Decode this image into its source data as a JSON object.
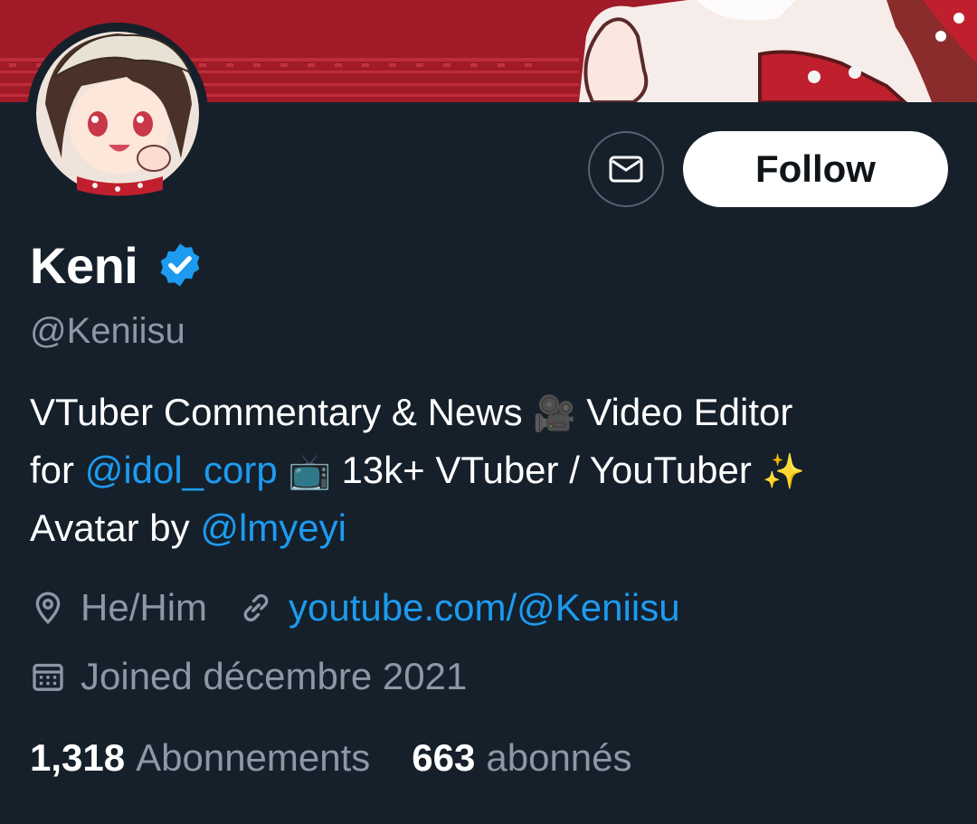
{
  "profile": {
    "display_name": "Keni",
    "handle": "@Keniisu",
    "bio": {
      "line1_text": "VTuber Commentary & News ",
      "line1_emoji": "🎥",
      "line1_end": " Video Editor",
      "line2_start": "for ",
      "line2_mention": "@idol_corp",
      "line2_emoji": " 📺",
      "line2_text": " 13k+ VTuber / YouTuber ",
      "line2_emoji2": "✨",
      "line3_start": "Avatar by ",
      "line3_mention": "@lmyeyi"
    },
    "location": "He/Him",
    "website": "youtube.com/@Keniisu",
    "joined": "Joined décembre 2021"
  },
  "stats": {
    "following_count": "1,318",
    "following_label": "Abonnements",
    "followers_count": "663",
    "followers_label": "abonnés"
  },
  "actions": {
    "follow_label": "Follow"
  },
  "icons": {
    "message": "envelope-icon",
    "verified": "verified-badge-icon",
    "location": "location-pin-icon",
    "link": "link-icon",
    "calendar": "calendar-icon"
  },
  "colors": {
    "background": "#15202b",
    "accent": "#1d9bf0",
    "muted_text": "#8b98a5",
    "banner_red": "#a01a28"
  }
}
